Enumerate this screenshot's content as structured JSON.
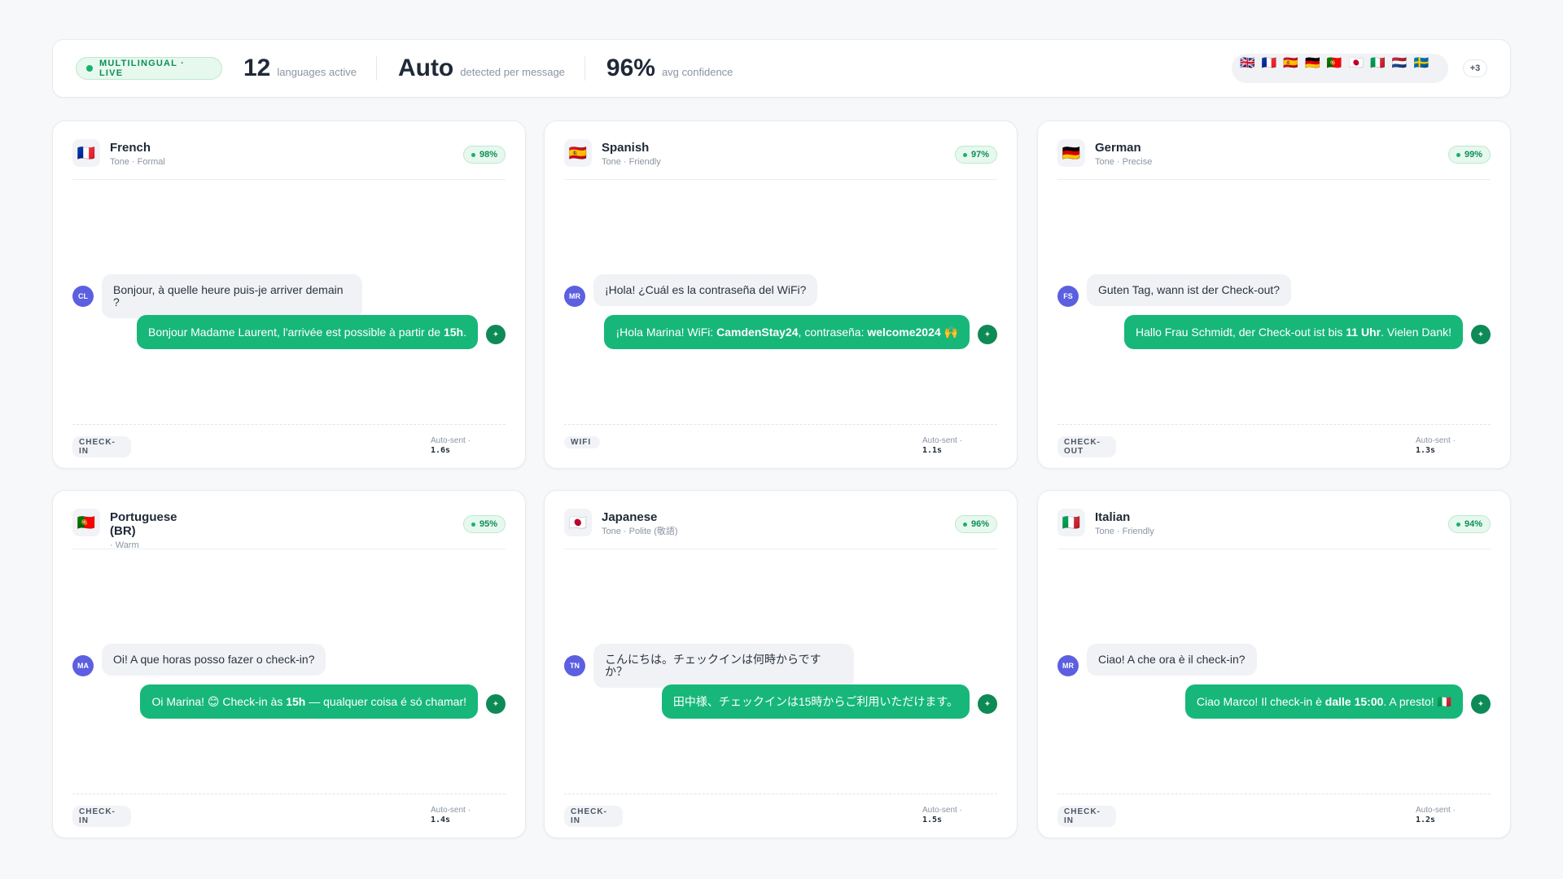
{
  "header": {
    "badge": "MULTILINGUAL · LIVE",
    "stats": [
      {
        "value": "12",
        "label": "languages active"
      },
      {
        "value": "Auto",
        "label": "detected per message"
      },
      {
        "value": "96%",
        "label": "avg confidence"
      }
    ],
    "flags": [
      "🇬🇧",
      "🇫🇷",
      "🇪🇸",
      "🇩🇪",
      "🇵🇹",
      "🇯🇵",
      "🇮🇹",
      "🇳🇱",
      "🇸🇪"
    ],
    "more": "+3"
  },
  "cards": [
    {
      "flag": "🇫🇷",
      "lang": "French",
      "tone": "Tone · Formal",
      "conf": "98%",
      "avatar": "CL",
      "guest": "Bonjour, à quelle heure puis-je arriver demain ?",
      "host": [
        "Bonjour Madame Laurent, l'arrivée est possible à partir de ",
        "15h",
        "."
      ],
      "tag": "CHECK-IN",
      "autosent": "Auto-sent ·",
      "time": "1.6s"
    },
    {
      "flag": "🇪🇸",
      "lang": "Spanish",
      "tone": "Tone · Friendly",
      "conf": "97%",
      "avatar": "MR",
      "guest": "¡Hola! ¿Cuál es la contraseña del WiFi?",
      "host": [
        "¡Hola Marina! WiFi: ",
        "CamdenStay24",
        ", contraseña: ",
        "welcome2024",
        " 🙌"
      ],
      "tag": "WIFI",
      "autosent": "Auto-sent ·",
      "time": "1.1s"
    },
    {
      "flag": "🇩🇪",
      "lang": "German",
      "tone": "Tone · Precise",
      "conf": "99%",
      "avatar": "FS",
      "guest": "Guten Tag, wann ist der Check-out?",
      "host": [
        "Hallo Frau Schmidt, der Check-out ist bis ",
        "11 Uhr",
        ". Vielen Dank!"
      ],
      "tag": "CHECK-OUT",
      "autosent": "Auto-sent ·",
      "time": "1.3s"
    },
    {
      "flag": "🇵🇹",
      "lang": "Portuguese (BR)",
      "tone": "· Warm",
      "conf": "95%",
      "avatar": "MA",
      "guest": "Oi! A que horas posso fazer o check-in?",
      "host": [
        "Oi Marina! 😊 Check-in às ",
        "15h",
        " — qualquer coisa é só chamar!"
      ],
      "tag": "CHECK-IN",
      "autosent": "Auto-sent ·",
      "time": "1.4s"
    },
    {
      "flag": "🇯🇵",
      "lang": "Japanese",
      "tone": "Tone · Polite (敬語)",
      "conf": "96%",
      "avatar": "TN",
      "guest": "こんにちは。チェックインは何時からですか？",
      "host": [
        "田中様、チェックインは15時からご利用いただけます。"
      ],
      "tag": "CHECK-IN",
      "autosent": "Auto-sent ·",
      "time": "1.5s"
    },
    {
      "flag": "🇮🇹",
      "lang": "Italian",
      "tone": "Tone · Friendly",
      "conf": "94%",
      "avatar": "MR",
      "guest": "Ciao! A che ora è il check-in?",
      "host": [
        "Ciao Marco! Il check-in è ",
        "dalle 15:00",
        ". A presto! 🇮🇹"
      ],
      "tag": "CHECK-IN",
      "autosent": "Auto-sent ·",
      "time": "1.2s"
    }
  ]
}
